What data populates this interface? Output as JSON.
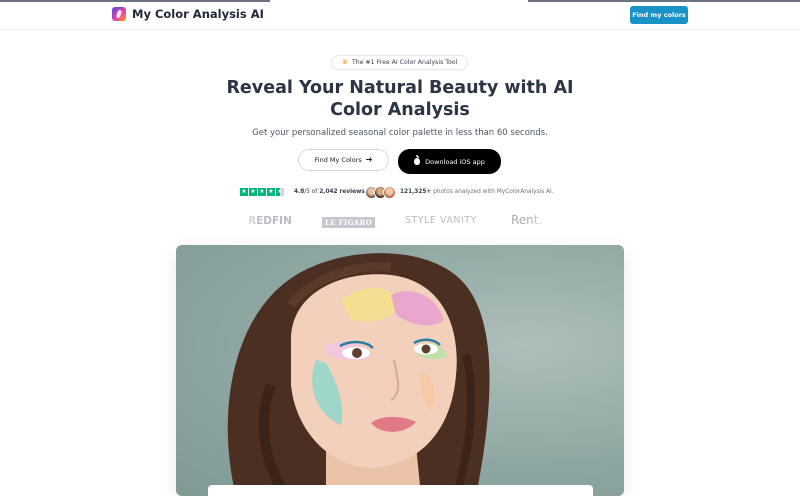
{
  "nav": {
    "brand": "My Color Analysis AI",
    "cta": "Find my colors"
  },
  "hero": {
    "badge": "The #1 Free AI Color Analysis Tool",
    "headline_line1": "Reveal Your Natural Beauty with AI",
    "headline_line2": "Color Analysis",
    "subhead": "Get your personalized seasonal color palette in less than 60 seconds.",
    "primary_button": "Find My Colors",
    "secondary_button": "Download iOS app"
  },
  "social_proof": {
    "stars": 4.5,
    "rating": "4.8",
    "rating_suffix": "/5 of",
    "reviews": "2,042 reviews",
    "photos_count": "121,325+",
    "photos_text": "photos analyzed with MyColorAnalysis AI."
  },
  "press_logos": [
    "REDFIN",
    "LE FIGARO",
    "STYLE VANITY",
    "Rent."
  ],
  "colors": {
    "accent": "#1992c8",
    "trustpilot": "#00b67a",
    "dark_button": "#000000"
  },
  "icons": {
    "badge": "crown-icon",
    "primary_button": "arrow-right-icon",
    "secondary_button": "apple-icon"
  }
}
